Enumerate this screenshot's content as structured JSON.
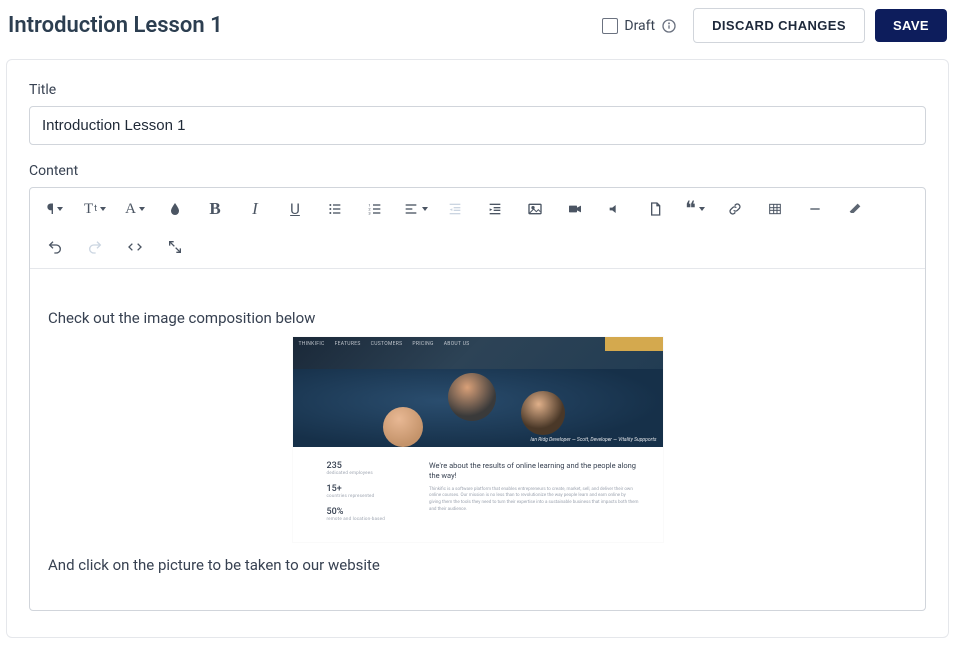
{
  "header": {
    "title": "Introduction Lesson 1",
    "draft_label": "Draft",
    "discard_label": "DISCARD CHANGES",
    "save_label": "SAVE"
  },
  "form": {
    "title_label": "Title",
    "title_value": "Introduction Lesson 1",
    "content_label": "Content"
  },
  "toolbar": {
    "paragraph": "¶",
    "textstyle": "T",
    "fontcolor": "A",
    "bold": "B",
    "italic": "I",
    "underline": "U"
  },
  "editor": {
    "line1": "Check out the image composition below",
    "line2": "And click on the picture to be taken to our website"
  },
  "embedded": {
    "nav": [
      "THINKIFIC",
      "FEATURES",
      "CUSTOMERS",
      "PRICING",
      "ABOUT US"
    ],
    "hero_caption": "Ian Ridg Developer — Scott, Developer — Vitality Suppports",
    "stats": [
      {
        "num": "235",
        "lbl": "dedicated employees"
      },
      {
        "num": "15+",
        "lbl": "countries represented"
      },
      {
        "num": "50%",
        "lbl": "remote and location-based"
      }
    ],
    "subhead": "We're about the results of online learning and the people along the way!",
    "subbody": "Thinkific is a software platform that enables entrepreneurs to create, market, sell, and deliver their own online courses. Our mission is no less than to revolutionize the way people learn and earn online by giving them the tools they need to turn their expertise into a sustainable business that impacts both them and their audience."
  }
}
